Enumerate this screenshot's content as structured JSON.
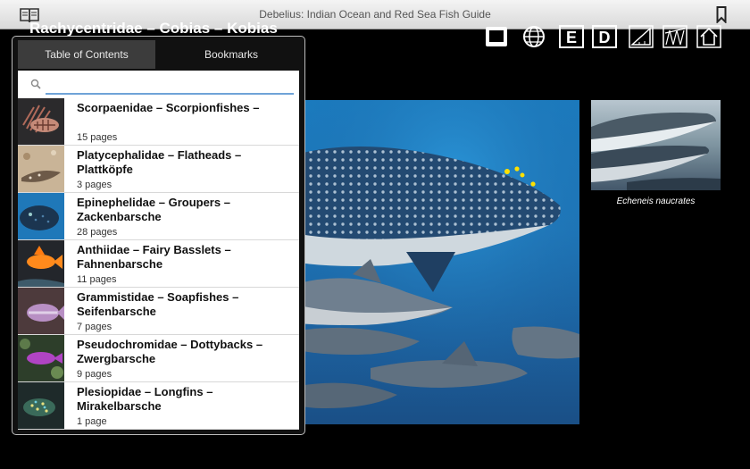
{
  "app": {
    "title": "Debelius: Indian Ocean and Red Sea Fish Guide"
  },
  "page": {
    "heading": "Rachycentridae – Cobias – Kobias",
    "thumb_caption": "Echeneis naucrates"
  },
  "nav_icons": [
    "square-icon",
    "globe-icon",
    "letter-e-icon",
    "letter-d-icon",
    "triangle-ruler-icon",
    "map-icon",
    "home-icon"
  ],
  "popup": {
    "tabs": [
      "Table of Contents",
      "Bookmarks"
    ],
    "search": {
      "value": "",
      "placeholder": ""
    },
    "items": [
      {
        "name": "Scorpaenidae – Scorpionfishes –",
        "pages": "15 pages",
        "thumb": "lionfish"
      },
      {
        "name": "Platycephalidae – Flatheads – Plattköpfe",
        "pages": "3 pages",
        "thumb": "flathead"
      },
      {
        "name": "Epinephelidae – Groupers – Zackenbarsche",
        "pages": "28 pages",
        "thumb": "grouper"
      },
      {
        "name": "Anthiidae – Fairy Basslets – Fahnenbarsche",
        "pages": "11 pages",
        "thumb": "anthias"
      },
      {
        "name": "Grammistidae – Soapfishes – Seifenbarsche",
        "pages": "7 pages",
        "thumb": "soapfish"
      },
      {
        "name": "Pseudochromidae – Dottybacks – Zwergbarsche",
        "pages": "9 pages",
        "thumb": "dottyback"
      },
      {
        "name": "Plesiopidae – Longfins – Mirakelbarsche",
        "pages": "1 page",
        "thumb": "longfin"
      }
    ]
  },
  "colors": {
    "topbar": "#e6e6e6",
    "popup_tab_active": "#3c3c3c",
    "search_underline": "#6fa3d8",
    "water": "#1c70b3"
  }
}
